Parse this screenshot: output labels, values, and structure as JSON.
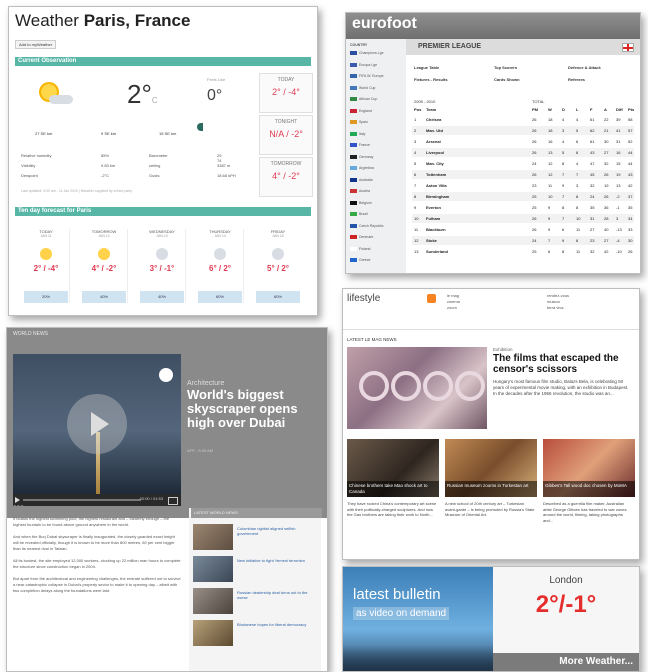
{
  "weather": {
    "title_prefix": "Weather",
    "title_location": "Paris, France",
    "add_button": "Add to myWeather",
    "current_header": "Current Observation",
    "current_temp": "2°",
    "current_unit": "C",
    "feels_label": "Feels Like",
    "feels_temp": "0°",
    "today_label": "TODAY",
    "today_temp": "2° / -4°",
    "tonight_label": "TONIGHT",
    "tonight_temp": "N/A / -2°",
    "tomorrow_label": "TOMORROW",
    "tomorrow_temp": "4° / -2°",
    "wind_values": [
      "27 SE km",
      "9 SE km",
      "15 SE km"
    ],
    "obs": [
      {
        "label": "Relative humidity",
        "value": "85%",
        "label2": "Barometer",
        "value2": "29 74"
      },
      {
        "label": "Visibility",
        "value": "9.83 km",
        "label2": "ceiling",
        "value2": "3387 m"
      },
      {
        "label": "Dewpoint",
        "value": "-2°C",
        "label2": "Gusts",
        "value2": "18.68 kPH"
      }
    ],
    "updated": "Last updated: 9:00 am - 11 Jan 2010 | Weather supplied by a third party",
    "forecast_header": "Ten day forecast for Paris",
    "forecast": [
      {
        "day": "TODAY",
        "date": "JAN 11",
        "temp": "2° / -4°",
        "precip": "20%"
      },
      {
        "day": "TOMORROW",
        "date": "JAN 12",
        "temp": "4° / -2°",
        "precip": "40%"
      },
      {
        "day": "WEDNESDAY",
        "date": "JAN 13",
        "temp": "3° / -1°",
        "precip": "40%"
      },
      {
        "day": "THURSDAY",
        "date": "JAN 14",
        "temp": "6° / 2°",
        "precip": "60%"
      },
      {
        "day": "FRIDAY",
        "date": "JAN 15",
        "temp": "5° / 2°",
        "precip": "60%"
      }
    ]
  },
  "eurofoot": {
    "logo": "eurofoot",
    "country_label": "COUNTRY",
    "league": "PREMIER LEAGUE",
    "countries": [
      "Champions Lge",
      "Europa Lge",
      "FIFA W. Europe",
      "World Cup",
      "African Cup",
      "England",
      "Spain",
      "Italy",
      "France",
      "Germany",
      "Argentina",
      "Australia",
      "Austria",
      "Belgium",
      "Brazil",
      "Czech Republic",
      "Denmark",
      "Finland",
      "Greece"
    ],
    "links_row1": [
      "League Table",
      "Top Scorers",
      "Defence & Attack"
    ],
    "links_row2": [
      "Fixtures - Results",
      "Cards Shown",
      "Referees"
    ],
    "season": "2009 - 2010",
    "total_label": "TOTAL",
    "columns": [
      "Pos",
      "Team",
      "PM",
      "W",
      "D",
      "L",
      "F",
      "A",
      "Diff",
      "Pts"
    ],
    "rows": [
      [
        "1",
        "Chelsea",
        "26",
        "18",
        "4",
        "4",
        "61",
        "22",
        "39",
        "58"
      ],
      [
        "2",
        "Man. Utd",
        "26",
        "18",
        "3",
        "5",
        "62",
        "21",
        "41",
        "57"
      ],
      [
        "3",
        "Arsenal",
        "26",
        "16",
        "4",
        "6",
        "61",
        "30",
        "31",
        "52"
      ],
      [
        "4",
        "Liverpool",
        "26",
        "13",
        "5",
        "8",
        "43",
        "27",
        "16",
        "44"
      ],
      [
        "5",
        "Man. City",
        "24",
        "12",
        "8",
        "4",
        "47",
        "32",
        "15",
        "44"
      ],
      [
        "6",
        "Tottenham",
        "26",
        "12",
        "7",
        "7",
        "45",
        "26",
        "19",
        "43"
      ],
      [
        "7",
        "Aston Villa",
        "23",
        "11",
        "9",
        "3",
        "32",
        "19",
        "13",
        "42"
      ],
      [
        "8",
        "Birmingham",
        "25",
        "10",
        "7",
        "8",
        "24",
        "26",
        "-2",
        "37"
      ],
      [
        "9",
        "Everton",
        "25",
        "9",
        "8",
        "8",
        "35",
        "36",
        "-1",
        "35"
      ],
      [
        "10",
        "Fulham",
        "26",
        "9",
        "7",
        "10",
        "31",
        "28",
        "3",
        "34"
      ],
      [
        "11",
        "Blackburn",
        "26",
        "9",
        "6",
        "11",
        "27",
        "40",
        "-13",
        "33"
      ],
      [
        "12",
        "Stoke",
        "24",
        "7",
        "9",
        "8",
        "23",
        "27",
        "-4",
        "30"
      ],
      [
        "13",
        "Sunderland",
        "25",
        "6",
        "8",
        "11",
        "32",
        "42",
        "-10",
        "26"
      ]
    ]
  },
  "lifestyle": {
    "logo": "lifestyle",
    "links_col1": [
      "le mag",
      "cinema",
      "zoom"
    ],
    "links_col2": [
      "rendez-vous",
      "musica",
      "terra viva"
    ],
    "section": "LATEST LE MAG NEWS",
    "hero_kicker": "Exhibition",
    "hero_headline": "The films that escaped the censor's scissors",
    "hero_lede": "Hungary's most famous film studio, Balazs Bela, is celebrating 50 years of experimental movie making, with an exhibition in Budapest. In the decades after the 1956 revolution, the studio was an...",
    "thumbs": [
      {
        "caption": "Chinese brothers take Mao shock art to Canada",
        "blurb": "They have rocked China's contemporary art scene with their politically-charged sculptures. And now the Gao brothers are taking their work to North..."
      },
      {
        "caption": "Russian museum zooms in Turkestan art",
        "blurb": "A new school of 20th century art – Turkestan avant-garde – is being promoted by Russia's State Museum of Oriental Art."
      },
      {
        "caption": "Gibbes's Tall wood doc chosen by MoMA",
        "blurb": "Described as a guerrilla film maker, Australian artist George Gittoes has traveled to war zones around the world, filming, taking photographs and..."
      }
    ]
  },
  "world": {
    "section": "WORLD NEWS",
    "tag": "Architecture",
    "headline": "World's biggest skyscraper opens high over Dubai",
    "byline": "AFP - 9:00 AM",
    "video_time": "00:00 / 01:53",
    "tools": "●●●",
    "paragraphs": [
      "It boasts the highest swimming pool, the highest restaurant and – bizarrely enough – the highest fountain to be found above ground anywhere in the world.",
      "And when the Burj Dubai skyscraper is finally inaugurated, the closely guarded exact height will be revealed officially, though it is known to be more than 800 metres, 60 per cent bigger than its nearest rival in Taiwan.",
      "All its busiest, the site employed 12,000 workers, clocking up 22 million man hours to complete the structure since construction began in 2004.",
      "But apart from the architectural and engineering challenges, the emirate suffered not to survive a near catastrophic collapse in Dubai's property sector to make it to opening day – albeit with two completion delays along the foundations were laid."
    ],
    "latest_header": "LATEST WORLD NEWS",
    "latest": [
      "Colombian rightist aligned selfish government",
      "New initiative to fight Yemeni terrorism",
      "Russian dealership deal turns out to the worse",
      "Bhutanese hopes for liberal democracy"
    ]
  },
  "bulletin": {
    "title": "latest bulletin",
    "subtitle": "as video on demand",
    "city": "London",
    "temp": "2°/-1°",
    "more": "More Weather..."
  }
}
